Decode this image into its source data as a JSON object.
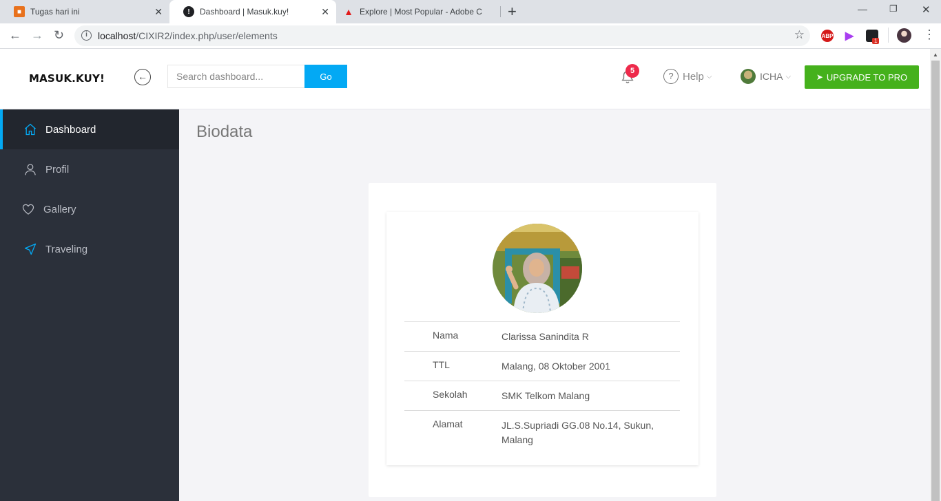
{
  "browser": {
    "tabs": [
      {
        "title": "Tugas hari ini",
        "favicon_color": "#e8711c"
      },
      {
        "title": "Dashboard | Masuk.kuy!",
        "favicon_color": "#202124"
      },
      {
        "title": "Explore | Most Popular - Adobe C",
        "favicon_color": "#e21b1b"
      }
    ],
    "url_host": "localhost",
    "url_path": "/CIXIR2/index.php/user/elements",
    "ext_abp": "ABP",
    "ext_badge": "1"
  },
  "header": {
    "logo": "MASUK.KUY!",
    "search_placeholder": "Search dashboard...",
    "go_label": "Go",
    "notification_count": "5",
    "help_label": "Help",
    "user_name": "ICHA",
    "upgrade_label": "UPGRADE TO PRO",
    "accent": "#03a9f4",
    "upgrade_color": "#45b11c"
  },
  "sidebar": {
    "items": [
      {
        "label": "Dashboard",
        "icon": "home-icon"
      },
      {
        "label": "Profil",
        "icon": "user-icon"
      },
      {
        "label": "Gallery",
        "icon": "heart-icon"
      },
      {
        "label": "Traveling",
        "icon": "navigation-icon"
      }
    ]
  },
  "main": {
    "title": "Biodata",
    "profile": {
      "rows": [
        {
          "label": "Nama",
          "value": "Clarissa Sanindita R"
        },
        {
          "label": "TTL",
          "value": "Malang, 08 Oktober 2001"
        },
        {
          "label": "Sekolah",
          "value": "SMK Telkom Malang"
        },
        {
          "label": "Alamat",
          "value": "JL.S.Supriadi GG.08 No.14, Sukun, Malang"
        }
      ]
    }
  }
}
